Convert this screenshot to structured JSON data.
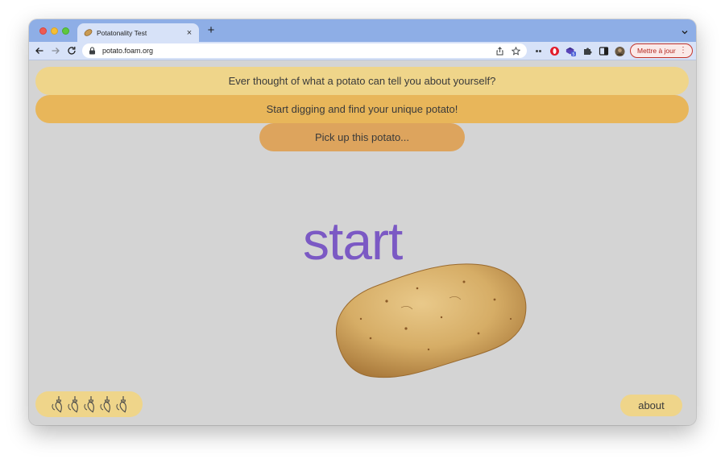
{
  "browser": {
    "tab_title": "Potatonality Test",
    "tab_favicon": "potato-icon",
    "url": "potato.foam.org",
    "update_button_label": "Mettre à jour",
    "extension_badge": "5",
    "accent_color": "#8eaee6"
  },
  "page": {
    "banner_1": "Ever thought of what a potato can tell you about yourself?",
    "banner_2": "Start digging and find your unique potato!",
    "banner_3": "Pick up this potato...",
    "start_label": "start",
    "about_label": "about",
    "trowel_icons": [
      "trowel-icon",
      "trowel-icon",
      "trowel-icon",
      "trowel-icon",
      "trowel-icon"
    ],
    "colors": {
      "background": "#d4d4d4",
      "banner_1": "#efd58a",
      "banner_2": "#e8b65a",
      "banner_3": "#dda45d",
      "start_text": "#7b59c4"
    }
  }
}
